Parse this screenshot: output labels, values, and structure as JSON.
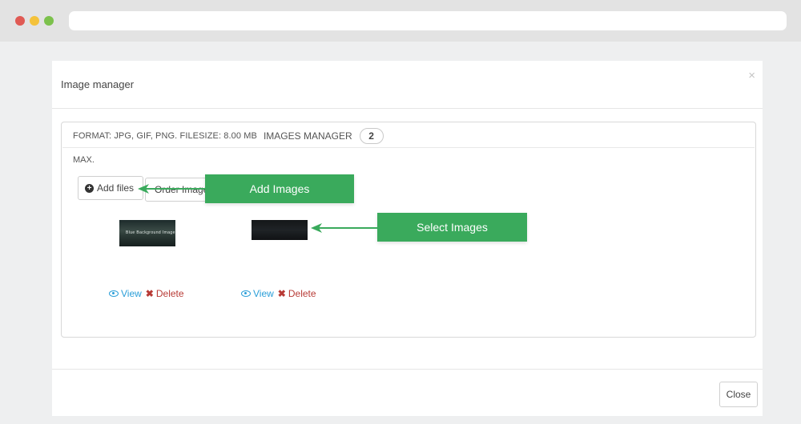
{
  "modal": {
    "title": "Image manager",
    "close_x": "×",
    "close_label": "Close"
  },
  "panel": {
    "format_text": "FORMAT: JPG, GIF, PNG. FILESIZE: 8.00 MB",
    "manager_label": "IMAGES MANAGER",
    "count": "2",
    "max_text": "MAX."
  },
  "buttons": {
    "add_files": "Add files",
    "order_images": "Order Images"
  },
  "images": [
    {
      "thumb_text": "Blue Background Image",
      "view_label": "View",
      "delete_label": "Delete"
    },
    {
      "view_label": "View",
      "delete_label": "Delete"
    }
  ],
  "callouts": {
    "add_images": "Add Images",
    "select_images": "Select Images",
    "color": "#3aaa5c"
  },
  "icons": {
    "add": "plus-circle-icon",
    "view": "eye-icon",
    "delete": "x-icon"
  }
}
